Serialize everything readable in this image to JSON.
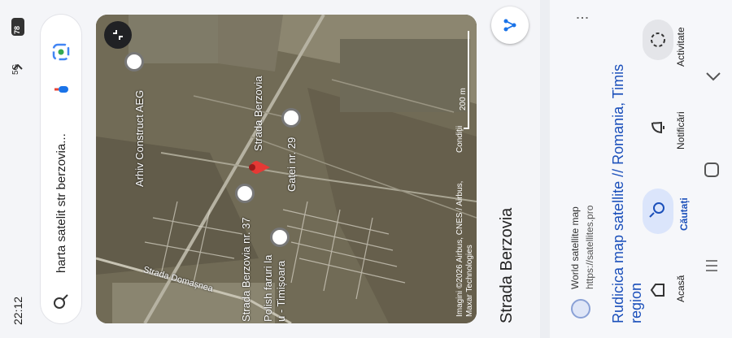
{
  "status": {
    "time": "22:12",
    "network": "5G",
    "battery": "78"
  },
  "search": {
    "query": "harta satelit str berzovia..."
  },
  "map": {
    "labels": {
      "arhiv": "Arhiv Construct AEG",
      "strada_berzovia": "Strada Berzovia",
      "gatei": "Gaței nr. 29",
      "berzovia37": "Strada Berzovia nr. 37",
      "polish_line1": "Polish faruri la",
      "polish_line2": "u - Timișoara",
      "domasnea": "Strada Domașnea"
    },
    "attribution": {
      "line1": "Imagini ©2026 Airbus, CNES / Airbus,",
      "line2": "Maxar Technologies",
      "conditions": "Condiții",
      "scale": "200 m"
    }
  },
  "place_title": "Strada Berzovia",
  "result": {
    "site_name": "World satellite map",
    "url": "https://satellites.pro",
    "title_line1": "Rudicica map satellite // Romania, Timis",
    "title_line2": "region"
  },
  "nav": {
    "acasa": "Acasă",
    "cautati": "Căutați",
    "notificari": "Notificări",
    "activitate": "Activitate"
  },
  "colors": {
    "accent": "#1a73e8",
    "pin": "#e53935",
    "link": "#1a4fba"
  }
}
